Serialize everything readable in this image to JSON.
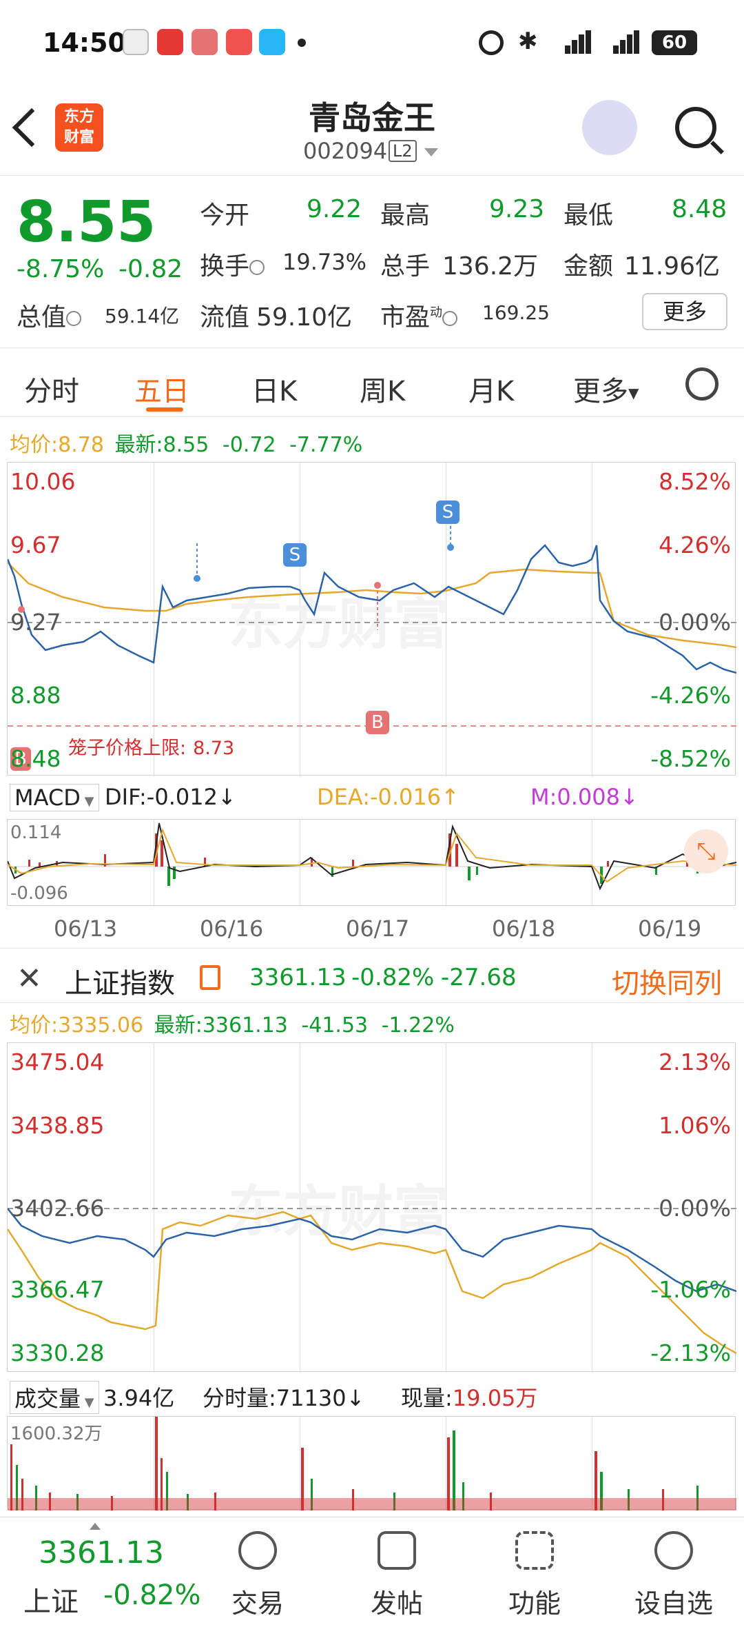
{
  "status_bar": {
    "time": "14:50",
    "battery": "60"
  },
  "header": {
    "title": "青岛金王",
    "code": "002094",
    "level": "L2",
    "logo_text_1": "东方",
    "logo_text_2": "财富"
  },
  "quote": {
    "price": "8.55",
    "change_pct": "-8.75%",
    "change": "-0.82",
    "open_label": "今开",
    "open": "9.22",
    "high_label": "最高",
    "high": "9.23",
    "low_label": "最低",
    "low": "8.48",
    "turnover_label": "换手",
    "turnover": "19.73%",
    "volume_label": "总手",
    "volume": "136.2万",
    "amount_label": "金额",
    "amount": "11.96亿",
    "mktcap_label": "总值",
    "mktcap": "59.14亿",
    "float_label": "流值",
    "float_cap": "59.10亿",
    "pe_label": "市盈",
    "pe_sup": "动",
    "pe": "169.25",
    "more_label": "更多"
  },
  "tabs": [
    {
      "label": "分时",
      "active": false
    },
    {
      "label": "五日",
      "active": true
    },
    {
      "label": "日K",
      "active": false
    },
    {
      "label": "周K",
      "active": false
    },
    {
      "label": "月K",
      "active": false
    },
    {
      "label": "更多",
      "active": false
    }
  ],
  "stock_chart": {
    "avg_label": "均价:",
    "avg": "8.78",
    "latest_label": "最新:",
    "latest": "8.55",
    "latest_change": "-0.72",
    "latest_pct": "-7.77%",
    "y_left": [
      "10.06",
      "9.67",
      "9.27",
      "8.88",
      "8.48"
    ],
    "y_right": [
      "8.52%",
      "4.26%",
      "0.00%",
      "-4.26%",
      "-8.52%"
    ],
    "limit_label": "笼子价格上限:",
    "limit_value": "8.73",
    "marker_s": "S",
    "marker_b": "B",
    "watermark": "东方财富"
  },
  "macd": {
    "name": "MACD",
    "dif": "DIF:-0.012↓",
    "dea": "DEA:-0.016↑",
    "m": "M:0.008↓",
    "ymax": "0.114",
    "ymin": "-0.096"
  },
  "dates": [
    "06/13",
    "06/16",
    "06/17",
    "06/18",
    "06/19"
  ],
  "index_bar": {
    "name": "上证指数",
    "value": "3361.13",
    "pct": "-0.82%",
    "change": "-27.68",
    "switch_label": "切换同列"
  },
  "index_chart": {
    "avg_label": "均价:",
    "avg": "3335.06",
    "latest_label": "最新:",
    "latest": "3361.13",
    "latest_change": "-41.53",
    "latest_pct": "-1.22%",
    "y_left": [
      "3475.04",
      "3438.85",
      "3402.66",
      "3366.47",
      "3330.28"
    ],
    "y_right": [
      "2.13%",
      "1.06%",
      "0.00%",
      "-1.06%",
      "-2.13%"
    ],
    "watermark": "东方财富"
  },
  "volume": {
    "name": "成交量",
    "total": "3.94亿",
    "minute_label": "分时量:",
    "minute": "71130↓",
    "current_label": "现量:",
    "current": "19.05万",
    "ymax": "1600.32万"
  },
  "bottom_nav": {
    "index_value": "3361.13",
    "index_name": "上证",
    "index_pct": "-0.82%",
    "items": [
      {
        "label": "交易",
        "icon": "trade-icon"
      },
      {
        "label": "发帖",
        "icon": "post-icon"
      },
      {
        "label": "功能",
        "icon": "grid-icon"
      },
      {
        "label": "设自选",
        "icon": "add-watchlist-icon"
      }
    ]
  },
  "colors": {
    "up": "#d32f2f",
    "down": "#109a2b",
    "accent": "#f26a1b",
    "avg_line": "#e5a82d",
    "price_line": "#2a62a8"
  }
}
